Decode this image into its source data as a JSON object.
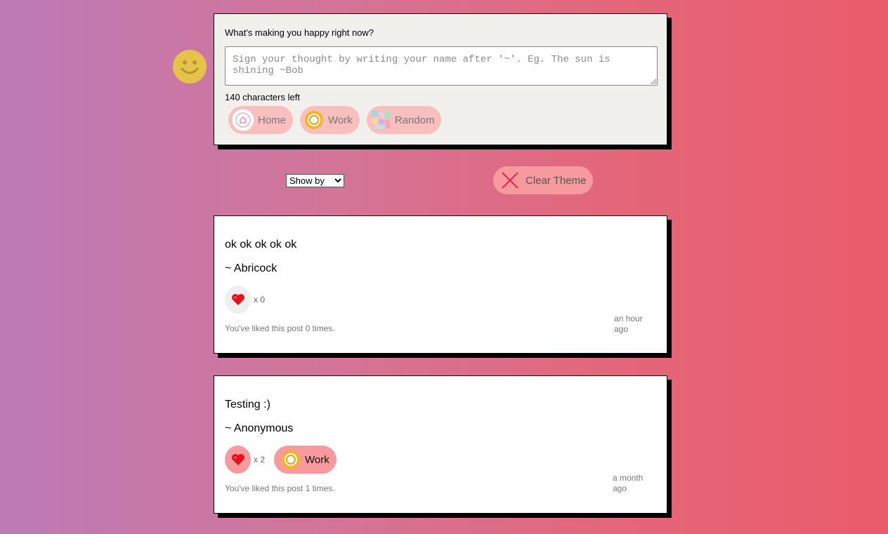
{
  "compose": {
    "prompt": "What's making you happy right now?",
    "placeholder": "Sign your thought by writing your name after '~'. Eg. The sun is shining ~Bob",
    "chars_left": "140 characters left",
    "themes": [
      {
        "label": "Home",
        "icon": "home-icon"
      },
      {
        "label": "Work",
        "icon": "gear-icon"
      },
      {
        "label": "Random",
        "icon": "random-icon"
      }
    ]
  },
  "controls": {
    "show_by": "Show by",
    "clear_theme": "Clear Theme"
  },
  "posts": [
    {
      "text": "ok ok ok ok ok",
      "author": "~ Abricock",
      "likes": "x 0",
      "liked_msg": "You've liked this post 0 times.",
      "time": "an hour ago"
    },
    {
      "text": "Testing :)",
      "author": "~ Anonymous",
      "likes": "x 2",
      "theme": "Work",
      "liked_msg": "You've liked this post 1 times.",
      "time": "a month ago"
    }
  ]
}
